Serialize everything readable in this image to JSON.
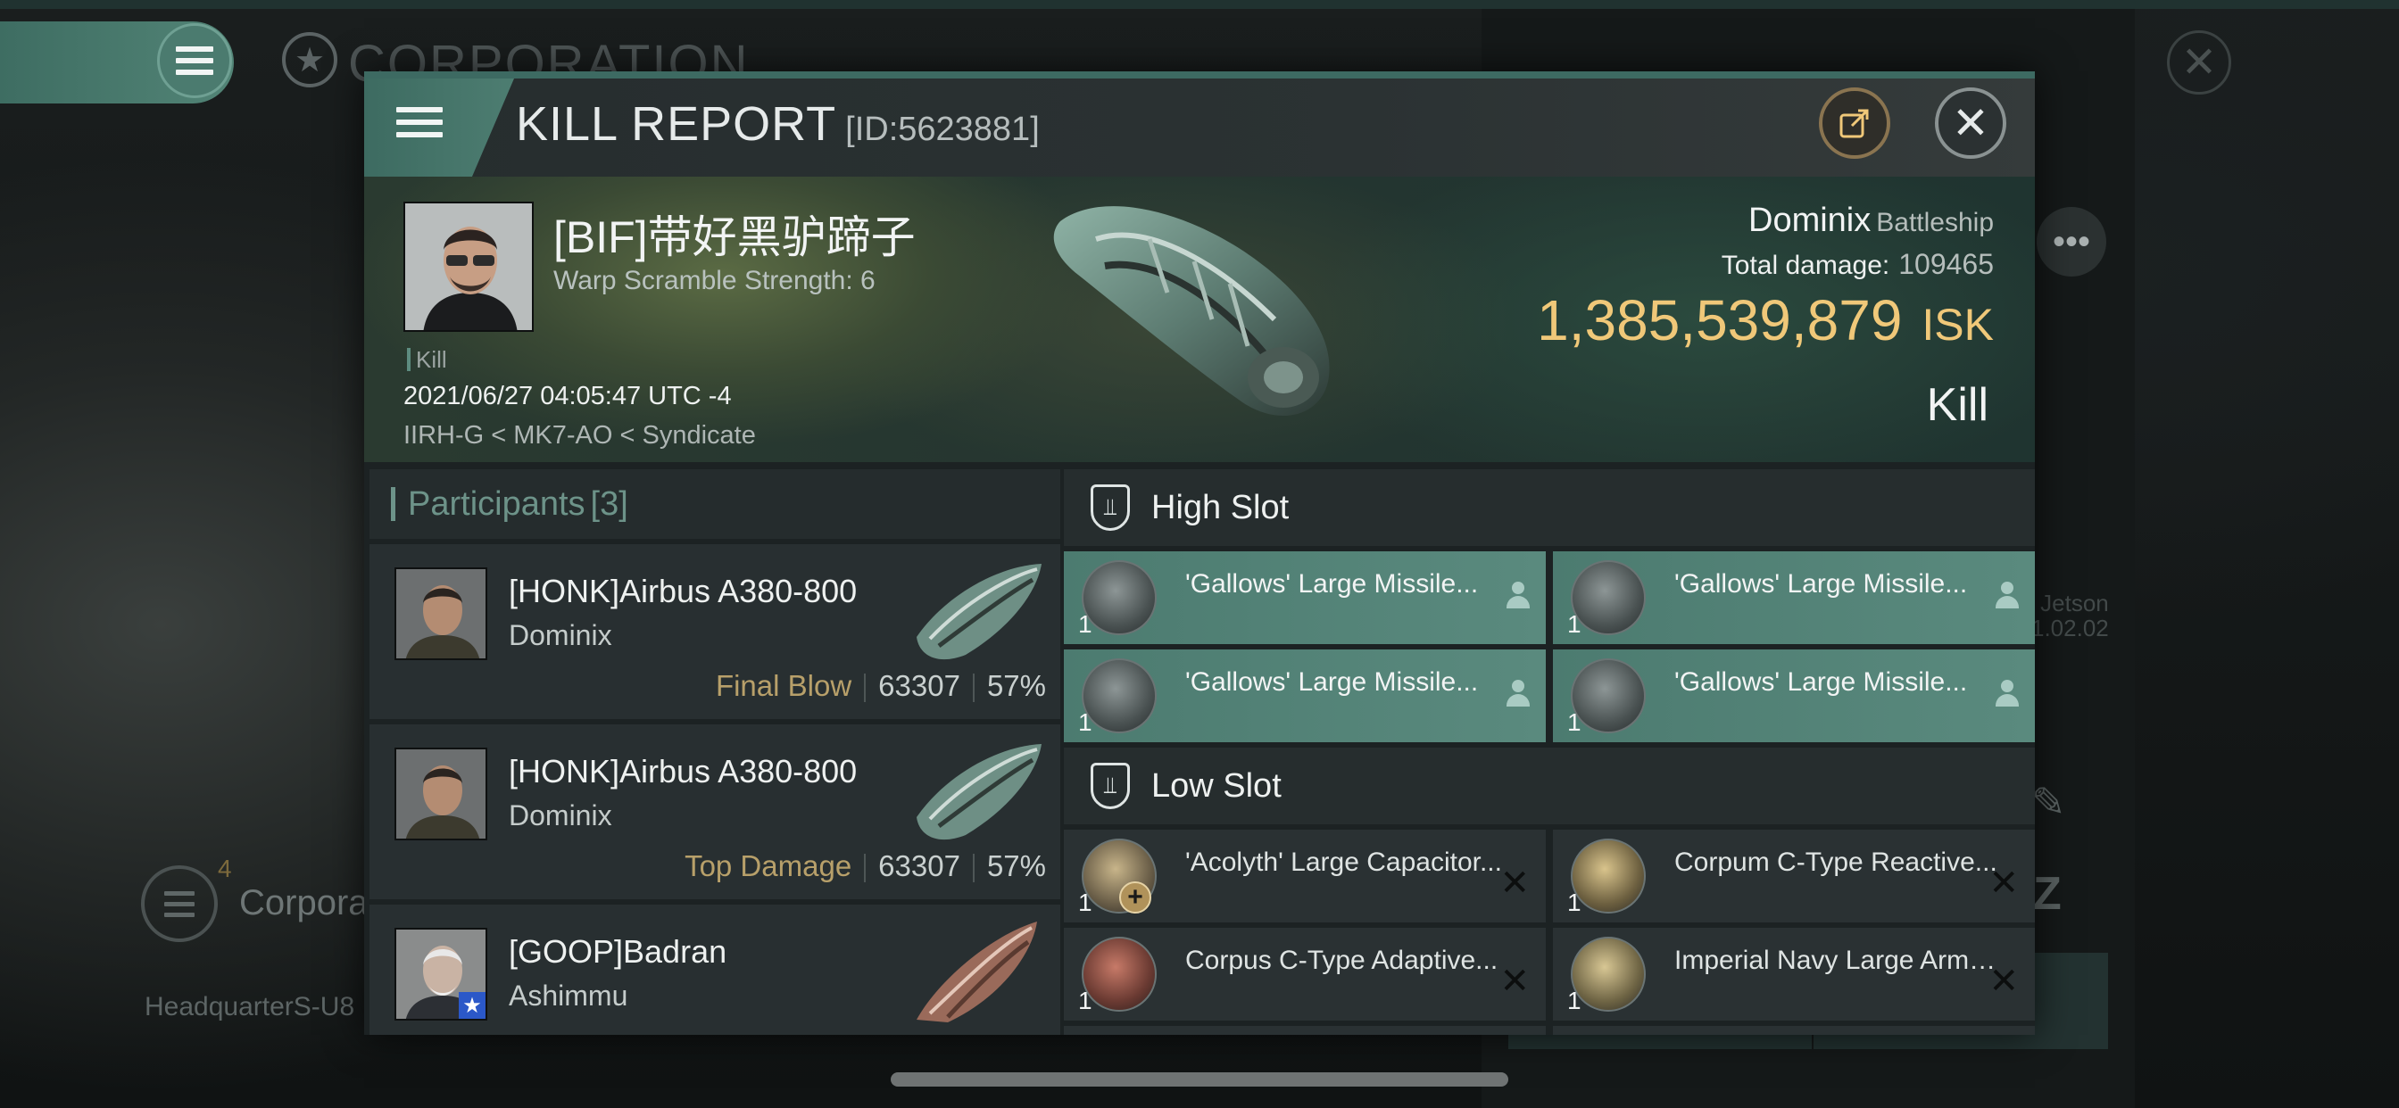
{
  "background": {
    "title": "CORPORATION",
    "corp_label": "Corporatio",
    "corp_count": "4",
    "hq_label": "Headquarter",
    "hq_value": "S-U8",
    "side_text_1": "Jetson",
    "side_text_2": "1.02.02"
  },
  "header": {
    "title": "KILL REPORT",
    "id": "[ID:5623881]"
  },
  "victim": {
    "name": "[BIF]带好黑驴蹄子",
    "warp_scramble": "Warp Scramble Strength: 6",
    "tag": "Kill",
    "date": "2021/06/27 04:05:47 UTC -4",
    "location": "IIRH-G < MK7-AO < Syndicate",
    "ship": "Dominix",
    "ship_class": "Battleship",
    "total_damage_label": "Total damage:",
    "total_damage": "109465",
    "isk_value": "1,385,539,879",
    "isk_unit": "ISK",
    "result": "Kill"
  },
  "participants": {
    "label": "Participants",
    "count": "[3]",
    "rows": [
      {
        "name": "[HONK]Airbus A380-800",
        "ship": "Dominix",
        "tag": "Final Blow",
        "damage": "63307",
        "percent": "57%"
      },
      {
        "name": "[HONK]Airbus A380-800",
        "ship": "Dominix",
        "tag": "Top Damage",
        "damage": "63307",
        "percent": "57%"
      },
      {
        "name": "[GOOP]Badran",
        "ship": "Ashimmu"
      }
    ]
  },
  "high_slot": {
    "label": "High Slot",
    "items": [
      {
        "name": "'Gallows' Large Missile...",
        "qty": "1"
      },
      {
        "name": "'Gallows' Large Missile...",
        "qty": "1"
      },
      {
        "name": "'Gallows' Large Missile...",
        "qty": "1"
      },
      {
        "name": "'Gallows' Large Missile...",
        "qty": "1"
      }
    ]
  },
  "low_slot": {
    "label": "Low Slot",
    "items": [
      {
        "name": "'Acolyth' Large Capacitor...",
        "qty": "1"
      },
      {
        "name": "Corpum C-Type Reactive...",
        "qty": "1"
      },
      {
        "name": "Corpus C-Type Adaptive...",
        "qty": "1"
      },
      {
        "name": "Imperial Navy Large Armor...",
        "qty": "1"
      }
    ]
  },
  "colors": {
    "accent": "#4d7d71",
    "isk": "#f0c879",
    "tag": "#b8a06a"
  }
}
